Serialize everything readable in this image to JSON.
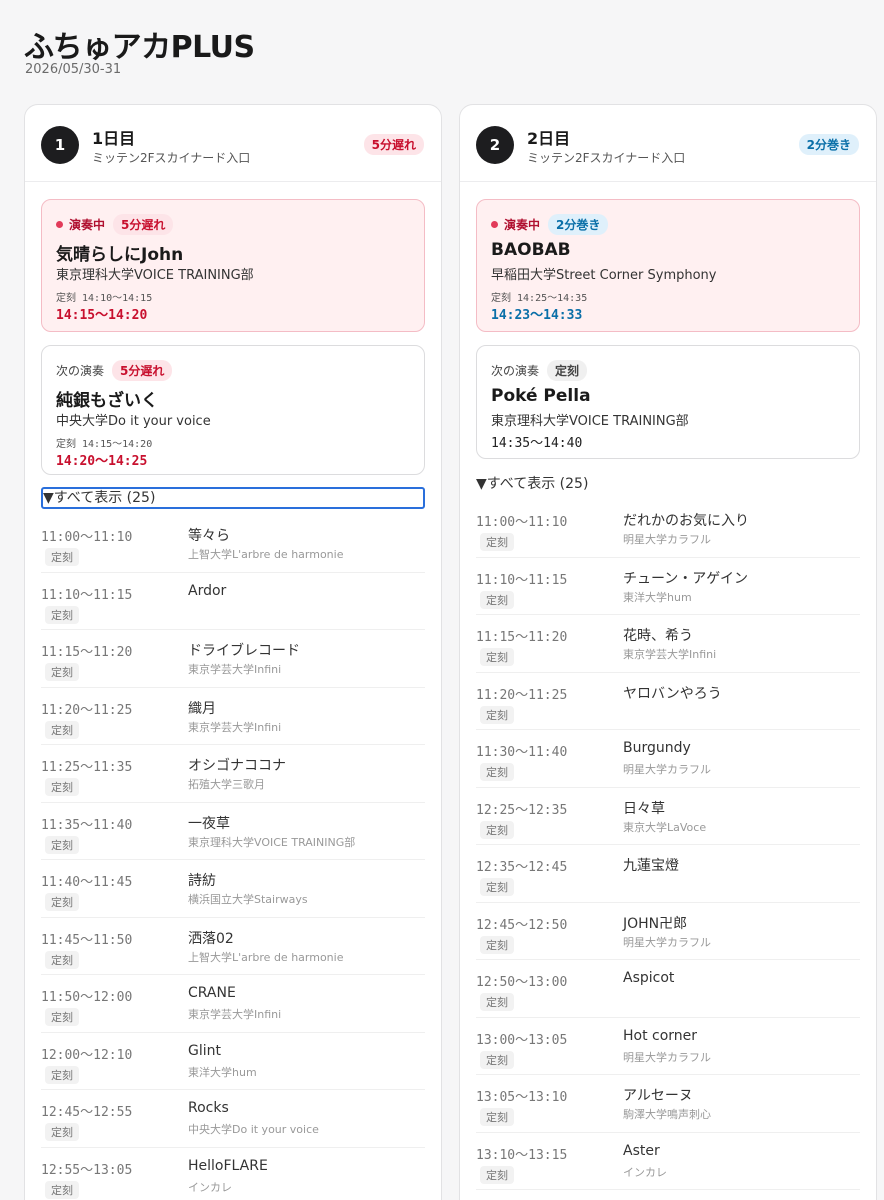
{
  "app": {
    "title": "ふちゅアカPLUS",
    "date": "2026/05/30-31"
  },
  "days": [
    {
      "num": "1",
      "label": "1日目",
      "venue": "ミッテン2Fスカイナード入口",
      "status": "5分遅れ",
      "now": {
        "tag": "演奏中",
        "status": "5分遅れ",
        "title": "気晴らしにJohn",
        "group": "東京理科大学VOICE TRAINING部",
        "scheduled": "定刻 14:10〜14:15",
        "actual": "14:15〜14:20"
      },
      "next": {
        "tag": "次の演奏",
        "status": "5分遅れ",
        "title": "純銀もざいく",
        "group": "中央大学Do it your voice",
        "scheduled": "定刻 14:15〜14:20",
        "actual": "14:20〜14:25"
      },
      "show_all": "▼すべて表示 (25)",
      "rows": [
        {
          "time": "11:00〜11:10",
          "status": "定刻",
          "title": "等々ら",
          "group": "上智大学L'arbre de harmonie"
        },
        {
          "time": "11:10〜11:15",
          "status": "定刻",
          "title": "Ardor",
          "group": ""
        },
        {
          "time": "11:15〜11:20",
          "status": "定刻",
          "title": "ドライブレコード",
          "group": "東京学芸大学Infini"
        },
        {
          "time": "11:20〜11:25",
          "status": "定刻",
          "title": "織月",
          "group": "東京学芸大学Infini"
        },
        {
          "time": "11:25〜11:35",
          "status": "定刻",
          "title": "オシゴナココナ",
          "group": "拓殖大学三歌月"
        },
        {
          "time": "11:35〜11:40",
          "status": "定刻",
          "title": "一夜草",
          "group": "東京理科大学VOICE TRAINING部"
        },
        {
          "time": "11:40〜11:45",
          "status": "定刻",
          "title": "詩紡",
          "group": "横浜国立大学Stairways"
        },
        {
          "time": "11:45〜11:50",
          "status": "定刻",
          "title": "洒落02",
          "group": "上智大学L'arbre de harmonie"
        },
        {
          "time": "11:50〜12:00",
          "status": "定刻",
          "title": "CRANE",
          "group": "東京学芸大学Infini"
        },
        {
          "time": "12:00〜12:10",
          "status": "定刻",
          "title": "Glint",
          "group": "東洋大学hum"
        },
        {
          "time": "12:45〜12:55",
          "status": "定刻",
          "title": "Rocks",
          "group": "中央大学Do it your voice"
        },
        {
          "time": "12:55〜13:05",
          "status": "定刻",
          "title": "HelloFLARE",
          "group": "インカレ"
        }
      ]
    },
    {
      "num": "2",
      "label": "2日目",
      "venue": "ミッテン2Fスカイナード入口",
      "status": "2分巻き",
      "now": {
        "tag": "演奏中",
        "status": "2分巻き",
        "title": "BAOBAB",
        "group": "早稲田大学Street Corner Symphony",
        "scheduled": "定刻 14:25〜14:35",
        "actual": "14:23〜14:33"
      },
      "next": {
        "tag": "次の演奏",
        "status": "定刻",
        "title": "Poké Pella",
        "group": "東京理科大学VOICE TRAINING部",
        "actual": "14:35〜14:40"
      },
      "show_all": "▼すべて表示 (25)",
      "rows": [
        {
          "time": "11:00〜11:10",
          "status": "定刻",
          "title": "だれかのお気に入り",
          "group": "明星大学カラフル"
        },
        {
          "time": "11:10〜11:15",
          "status": "定刻",
          "title": "チューン・アゲイン",
          "group": "東洋大学hum"
        },
        {
          "time": "11:15〜11:20",
          "status": "定刻",
          "title": "花時、希う",
          "group": "東京学芸大学Infini"
        },
        {
          "time": "11:20〜11:25",
          "status": "定刻",
          "title": "ヤロバンやろう",
          "group": ""
        },
        {
          "time": "11:30〜11:40",
          "status": "定刻",
          "title": "Burgundy",
          "group": "明星大学カラフル"
        },
        {
          "time": "12:25〜12:35",
          "status": "定刻",
          "title": "日々草",
          "group": "東京大学LaVoce"
        },
        {
          "time": "12:35〜12:45",
          "status": "定刻",
          "title": "九蓮宝燈",
          "group": ""
        },
        {
          "time": "12:45〜12:50",
          "status": "定刻",
          "title": "JOHN卍郎",
          "group": "明星大学カラフル"
        },
        {
          "time": "12:50〜13:00",
          "status": "定刻",
          "title": "Aspicot",
          "group": ""
        },
        {
          "time": "13:00〜13:05",
          "status": "定刻",
          "title": "Hot corner",
          "group": "明星大学カラフル"
        },
        {
          "time": "13:05〜13:10",
          "status": "定刻",
          "title": "アルセーヌ",
          "group": "駒澤大学鳴声刺心"
        },
        {
          "time": "13:10〜13:15",
          "status": "定刻",
          "title": "Aster",
          "group": "インカレ"
        }
      ]
    }
  ]
}
